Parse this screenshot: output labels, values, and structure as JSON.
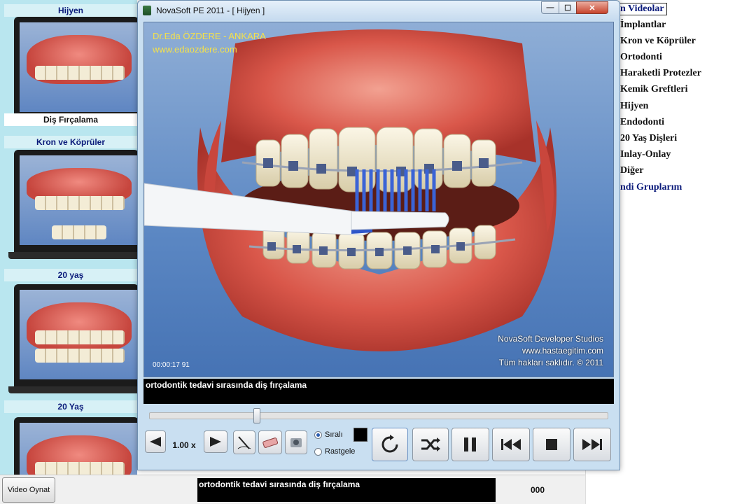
{
  "thumbnails": [
    {
      "title": "Hijyen",
      "caption": "Diş Fırçalama"
    },
    {
      "title": "Kron ve Köprüler",
      "caption": ""
    },
    {
      "title": "20 yaş",
      "caption": ""
    },
    {
      "title": "20 Yaş",
      "caption": ""
    }
  ],
  "menu": {
    "items": [
      {
        "label": "n Videolar",
        "style": "blue-boxed"
      },
      {
        "label": "İmplantlar"
      },
      {
        "label": "Kron ve Köprüler"
      },
      {
        "label": "Ortodonti"
      },
      {
        "label": "Haraketli Protezler"
      },
      {
        "label": "Kemik Greftleri"
      },
      {
        "label": "Hijyen"
      },
      {
        "label": "Endodonti"
      },
      {
        "label": "20 Yaş Dişleri"
      },
      {
        "label": "Inlay-Onlay"
      },
      {
        "label": "Diğer"
      },
      {
        "label": "ndi Gruplarım",
        "style": "blue"
      }
    ]
  },
  "bottom_bar": {
    "video_button": "Video Oynat",
    "caption": "ortodontik tedavi sırasında diş fırçalama",
    "counter": "000"
  },
  "window": {
    "title": "NovaSoft PE 2011 - [ Hijyen ]",
    "controls": {
      "minimize": "—",
      "maximize": "☐",
      "close": "✕"
    }
  },
  "video": {
    "author": "Dr.Eda ÖZDERE - ANKARA",
    "site": "www.edaozdere.com",
    "timestamp": "00:00:17 91",
    "studio": "NovaSoft Developer Studios",
    "studio_site": "www.hastaegitim.com",
    "rights": "Tüm hakları saklıdır. © 2011"
  },
  "caption": "ortodontik tedavi sırasında diş fırçalama",
  "player": {
    "seek_fraction": 0.23,
    "speed": "1.00 x",
    "order_options": [
      {
        "label": "Sıralı",
        "selected": true
      },
      {
        "label": "Rastgele",
        "selected": false
      }
    ],
    "pen_color": "#000000",
    "icons": [
      "rewind-icon",
      "fast-forward-icon",
      "pen-icon",
      "eraser-icon",
      "camera-icon",
      "replay-icon",
      "shuffle-icon",
      "pause-icon",
      "skip-back-icon",
      "stop-icon",
      "skip-forward-icon"
    ]
  },
  "colors": {
    "thumb_bg": "#b9e6ef",
    "title_blue": "#0a1a7a",
    "watermark_yellow": "#f5e14a",
    "video_bg": "#5b87c3"
  }
}
